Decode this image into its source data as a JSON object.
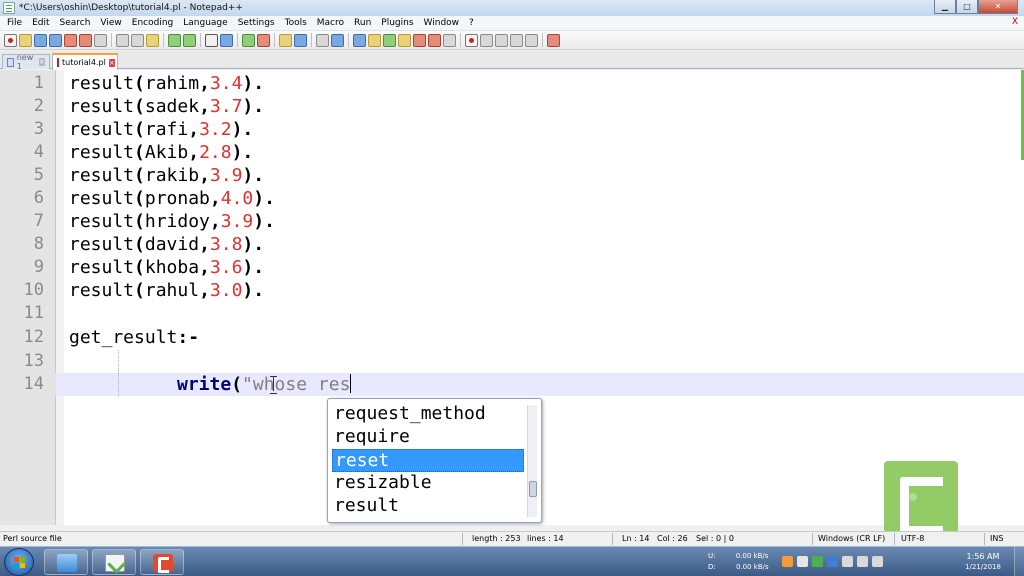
{
  "window": {
    "title": "*C:\\Users\\oshin\\Desktop\\tutorial4.pl - Notepad++",
    "controls": {
      "minimize": "▁",
      "maximize": "□",
      "close": "✕"
    }
  },
  "menu": {
    "items": [
      "File",
      "Edit",
      "Search",
      "View",
      "Encoding",
      "Language",
      "Settings",
      "Tools",
      "Macro",
      "Run",
      "Plugins",
      "Window",
      "?"
    ],
    "close": "X"
  },
  "toolbar": {
    "icons": [
      "new-file-icon",
      "open-file-icon",
      "save-icon",
      "save-all-icon",
      "close-icon",
      "close-all-icon",
      "print-icon",
      "cut-icon",
      "copy-icon",
      "paste-icon",
      "undo-icon",
      "redo-icon",
      "find-icon",
      "replace-icon",
      "zoom-in-icon",
      "zoom-out-icon",
      "sync-v-icon",
      "sync-h-icon",
      "word-wrap-icon",
      "show-all-icon",
      "indent-guide-icon",
      "udl-icon",
      "doc-map-icon",
      "function-list-icon",
      "folder-workspace-icon",
      "monitor-icon",
      "record-macro-icon",
      "stop-record-icon",
      "play-macro-icon",
      "run-macro-icon",
      "save-macro-icon",
      "spellcheck-icon"
    ]
  },
  "tabs": [
    {
      "label": "new 1",
      "active": false
    },
    {
      "label": "tutorial4.pl",
      "active": true
    }
  ],
  "editor": {
    "lines": [
      {
        "num": "1",
        "fn": "result",
        "arg": "rahim",
        "val": "3.4"
      },
      {
        "num": "2",
        "fn": "result",
        "arg": "sadek",
        "val": "3.7"
      },
      {
        "num": "3",
        "fn": "result",
        "arg": "rafi",
        "val": "3.2"
      },
      {
        "num": "4",
        "fn": "result",
        "arg": "Akib",
        "val": "2.8"
      },
      {
        "num": "5",
        "fn": "result",
        "arg": "rakib",
        "val": "3.9"
      },
      {
        "num": "6",
        "fn": "result",
        "arg": "pronab",
        "val": "4.0"
      },
      {
        "num": "7",
        "fn": "result",
        "arg": "hridoy",
        "val": "3.9"
      },
      {
        "num": "8",
        "fn": "result",
        "arg": "david",
        "val": "3.8"
      },
      {
        "num": "9",
        "fn": "result",
        "arg": "khoba",
        "val": "3.6"
      },
      {
        "num": "10",
        "fn": "result",
        "arg": "rahul",
        "val": "3.0"
      }
    ],
    "line11": "11",
    "line12": {
      "num": "12",
      "text": "get_result",
      "op": ":-"
    },
    "line13": "13",
    "line14": {
      "num": "14",
      "kw": "write",
      "paren": "(",
      "str": "\"whose res"
    }
  },
  "autocomplete": {
    "items": [
      "request_method",
      "require",
      "reset",
      "resizable",
      "result"
    ],
    "selected": "reset"
  },
  "statusbar": {
    "language": "Perl source file",
    "length": "length : 253",
    "lines": "lines : 14",
    "ln": "Ln : 14",
    "col": "Col : 26",
    "sel": "Sel : 0 | 0",
    "eol": "Windows (CR LF)",
    "encoding": "UTF-8",
    "mode": "INS"
  },
  "taskbar": {
    "net_up_label": "U:",
    "net_up": "0.00 kB/s",
    "net_down_label": "D:",
    "net_down": "0.00 kB/s",
    "time": "1:56 AM",
    "date": "1/21/2018"
  },
  "colors": {
    "keyword": "#000080",
    "number": "#e03030",
    "string": "#808080",
    "selection": "#3399ff",
    "current_line": "#e8e8ff",
    "tab_accent": "#f7a23b"
  }
}
